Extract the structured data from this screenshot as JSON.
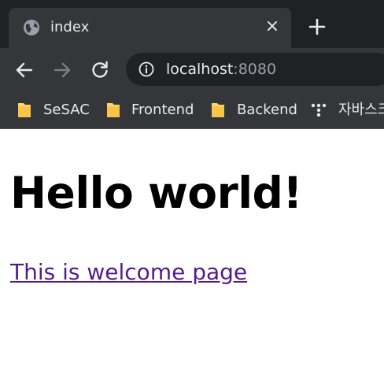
{
  "browser": {
    "tab": {
      "title": "index",
      "icon": "globe-icon",
      "close": "×"
    },
    "new_tab": "+",
    "omnibox": {
      "host": "localhost",
      "port": ":8080"
    },
    "bookmarks": [
      {
        "label": "SeSAC",
        "icon": "folder-icon"
      },
      {
        "label": "Frontend",
        "icon": "folder-icon"
      },
      {
        "label": "Backend",
        "icon": "folder-icon"
      },
      {
        "label": "자바스크",
        "icon": "bookmark-favicon"
      }
    ],
    "colors": {
      "tabstrip": "#202124",
      "toolbar": "#35363a",
      "folder": "#fdd663",
      "visited_link": "#551a8b"
    }
  },
  "page": {
    "heading": "Hello world!",
    "link_text": "This is welcome page"
  }
}
